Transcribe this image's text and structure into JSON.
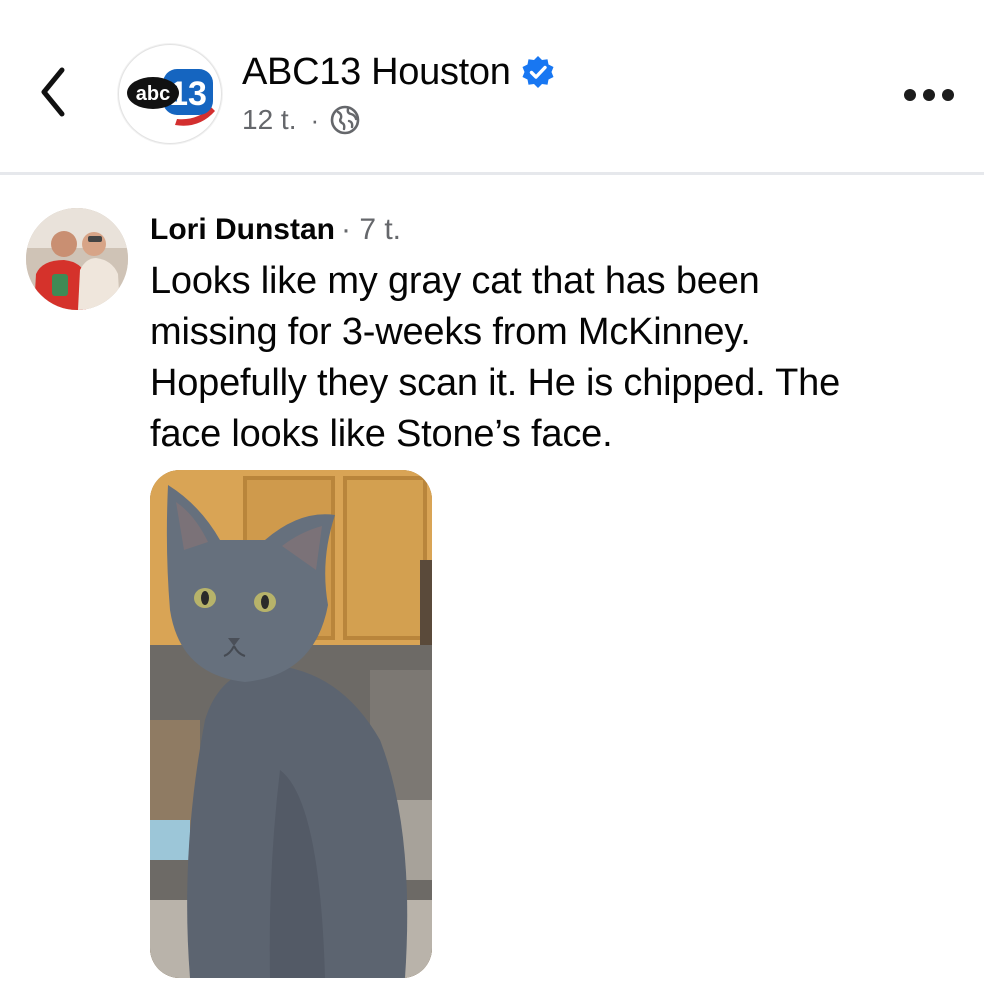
{
  "header": {
    "page_name": "ABC13 Houston",
    "post_time": "12 t.",
    "meta_separator": "·",
    "verified_icon": "verified-badge-icon",
    "privacy_icon": "globe-icon",
    "back_icon": "chevron-left-icon",
    "more_icon": "more-options-icon",
    "logo_text_abc": "abc",
    "logo_text_13": "13"
  },
  "comment": {
    "author": "Lori Dunstan",
    "time": "· 7 t.",
    "lines": [
      "Looks like my gray cat that has been",
      "missing for 3-weeks from McKinney.",
      "Hopefully they scan it. He is chipped. The",
      "face looks like Stone’s face."
    ]
  },
  "colors": {
    "verified_blue": "#1877f2",
    "abc13_blue": "#1565c0",
    "abc13_red": "#d32f2f",
    "secondary_text": "#65676b",
    "divider": "#e6e8ec"
  }
}
